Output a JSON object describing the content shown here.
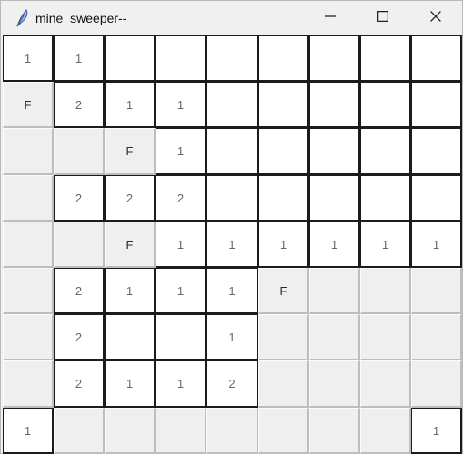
{
  "window": {
    "title": "mine_sweeper--",
    "app_icon": "feather-icon",
    "controls": {
      "minimize": "minimize-icon",
      "maximize": "maximize-icon",
      "close": "close-icon"
    }
  },
  "board": {
    "rows": 9,
    "cols": 9,
    "cells": [
      [
        {
          "text": "1",
          "state": "revealed"
        },
        {
          "text": "1",
          "state": "revealed"
        },
        {
          "text": "",
          "state": "revealed"
        },
        {
          "text": "",
          "state": "revealed"
        },
        {
          "text": "",
          "state": "revealed"
        },
        {
          "text": "",
          "state": "revealed"
        },
        {
          "text": "",
          "state": "revealed"
        },
        {
          "text": "",
          "state": "revealed"
        },
        {
          "text": "",
          "state": "revealed"
        }
      ],
      [
        {
          "text": "F",
          "state": "flagged"
        },
        {
          "text": "2",
          "state": "revealed"
        },
        {
          "text": "1",
          "state": "revealed"
        },
        {
          "text": "1",
          "state": "revealed"
        },
        {
          "text": "",
          "state": "revealed"
        },
        {
          "text": "",
          "state": "revealed"
        },
        {
          "text": "",
          "state": "revealed"
        },
        {
          "text": "",
          "state": "revealed"
        },
        {
          "text": "",
          "state": "revealed"
        }
      ],
      [
        {
          "text": "",
          "state": "covered"
        },
        {
          "text": "",
          "state": "covered"
        },
        {
          "text": "F",
          "state": "flagged"
        },
        {
          "text": "1",
          "state": "revealed"
        },
        {
          "text": "",
          "state": "revealed"
        },
        {
          "text": "",
          "state": "revealed"
        },
        {
          "text": "",
          "state": "revealed"
        },
        {
          "text": "",
          "state": "revealed"
        },
        {
          "text": "",
          "state": "revealed"
        }
      ],
      [
        {
          "text": "",
          "state": "covered"
        },
        {
          "text": "2",
          "state": "revealed"
        },
        {
          "text": "2",
          "state": "revealed"
        },
        {
          "text": "2",
          "state": "revealed"
        },
        {
          "text": "",
          "state": "revealed"
        },
        {
          "text": "",
          "state": "revealed"
        },
        {
          "text": "",
          "state": "revealed"
        },
        {
          "text": "",
          "state": "revealed"
        },
        {
          "text": "",
          "state": "revealed"
        }
      ],
      [
        {
          "text": "",
          "state": "covered"
        },
        {
          "text": "",
          "state": "covered"
        },
        {
          "text": "F",
          "state": "flagged"
        },
        {
          "text": "1",
          "state": "revealed"
        },
        {
          "text": "1",
          "state": "revealed"
        },
        {
          "text": "1",
          "state": "revealed"
        },
        {
          "text": "1",
          "state": "revealed"
        },
        {
          "text": "1",
          "state": "revealed"
        },
        {
          "text": "1",
          "state": "revealed"
        }
      ],
      [
        {
          "text": "",
          "state": "covered"
        },
        {
          "text": "2",
          "state": "revealed"
        },
        {
          "text": "1",
          "state": "revealed"
        },
        {
          "text": "1",
          "state": "revealed"
        },
        {
          "text": "1",
          "state": "revealed"
        },
        {
          "text": "F",
          "state": "flagged"
        },
        {
          "text": "",
          "state": "covered"
        },
        {
          "text": "",
          "state": "covered"
        },
        {
          "text": "",
          "state": "covered"
        }
      ],
      [
        {
          "text": "",
          "state": "covered"
        },
        {
          "text": "2",
          "state": "revealed"
        },
        {
          "text": "",
          "state": "revealed"
        },
        {
          "text": "",
          "state": "revealed"
        },
        {
          "text": "1",
          "state": "revealed"
        },
        {
          "text": "",
          "state": "covered"
        },
        {
          "text": "",
          "state": "covered"
        },
        {
          "text": "",
          "state": "covered"
        },
        {
          "text": "",
          "state": "covered"
        }
      ],
      [
        {
          "text": "",
          "state": "covered"
        },
        {
          "text": "2",
          "state": "revealed"
        },
        {
          "text": "1",
          "state": "revealed"
        },
        {
          "text": "1",
          "state": "revealed"
        },
        {
          "text": "2",
          "state": "revealed"
        },
        {
          "text": "",
          "state": "covered"
        },
        {
          "text": "",
          "state": "covered"
        },
        {
          "text": "",
          "state": "covered"
        },
        {
          "text": "",
          "state": "covered"
        }
      ],
      [
        {
          "text": "1",
          "state": "revealed"
        },
        {
          "text": "",
          "state": "covered"
        },
        {
          "text": "",
          "state": "covered"
        },
        {
          "text": "",
          "state": "covered"
        },
        {
          "text": "",
          "state": "covered"
        },
        {
          "text": "",
          "state": "covered"
        },
        {
          "text": "",
          "state": "covered"
        },
        {
          "text": "",
          "state": "covered"
        },
        {
          "text": "1",
          "state": "revealed"
        }
      ]
    ]
  },
  "colors": {
    "window_bg": "#f0f0f0",
    "covered_bg": "#efefef",
    "revealed_bg": "#ffffff",
    "number_text": "#686868"
  }
}
